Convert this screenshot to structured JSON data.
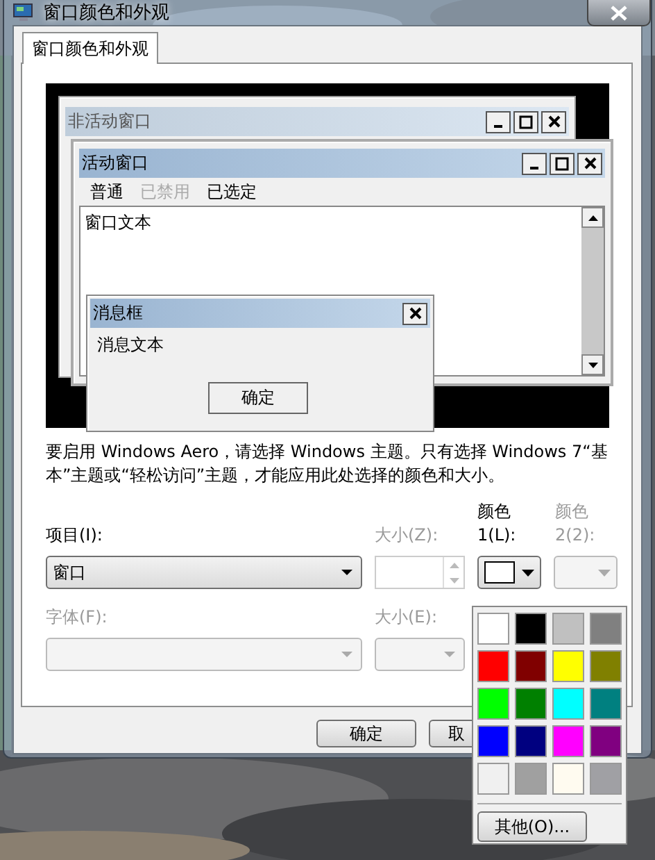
{
  "window": {
    "title": "窗口颜色和外观"
  },
  "tabs": [
    {
      "label": "窗口颜色和外观",
      "selected": true
    }
  ],
  "preview": {
    "inactive_window": {
      "title": "非活动窗口"
    },
    "active_window": {
      "title": "活动窗口",
      "menu": [
        {
          "label": "普通",
          "disabled": false
        },
        {
          "label": "已禁用",
          "disabled": true
        },
        {
          "label": "已选定",
          "disabled": false
        }
      ],
      "text": "窗口文本"
    },
    "message_box": {
      "title": "消息框",
      "text": "消息文本",
      "button": "确定"
    }
  },
  "note": "要启用 Windows Aero，请选择 Windows 主题。只有选择 Windows 7“基本”主题或“轻松访问”主题，才能应用此处选择的颜色和大小。",
  "fields": {
    "item": {
      "label": "项目(I):",
      "value": "窗口",
      "disabled": false
    },
    "item_size": {
      "label": "大小(Z):",
      "disabled": true
    },
    "color1": {
      "label": "颜色 1(L):",
      "disabled": false,
      "color": "#ffffff"
    },
    "color2": {
      "label": "颜色 2(2):",
      "disabled": true
    },
    "font": {
      "label": "字体(F):",
      "disabled": true
    },
    "font_size": {
      "label": "大小(E):",
      "disabled": true
    }
  },
  "buttons": [
    {
      "label": "确定"
    },
    {
      "label": "取"
    }
  ],
  "palette": {
    "swatches": [
      {
        "color": "#ffffff"
      },
      {
        "color": "#000000"
      },
      {
        "color": "#c0c0c0"
      },
      {
        "color": "#808080"
      },
      {
        "color": "#ff0000"
      },
      {
        "color": "#800000"
      },
      {
        "color": "#ffff00"
      },
      {
        "color": "#808000"
      },
      {
        "color": "#00ff00"
      },
      {
        "color": "#008000"
      },
      {
        "color": "#00ffff"
      },
      {
        "color": "#008080"
      },
      {
        "color": "#0000ff"
      },
      {
        "color": "#000080"
      },
      {
        "color": "#ff00ff"
      },
      {
        "color": "#800080"
      },
      {
        "color": "#f0f0f0"
      },
      {
        "color": "#a0a0a0"
      },
      {
        "color": "#fffbf0"
      },
      {
        "color": "#a0a0a4"
      }
    ],
    "more": "其他(O)..."
  }
}
